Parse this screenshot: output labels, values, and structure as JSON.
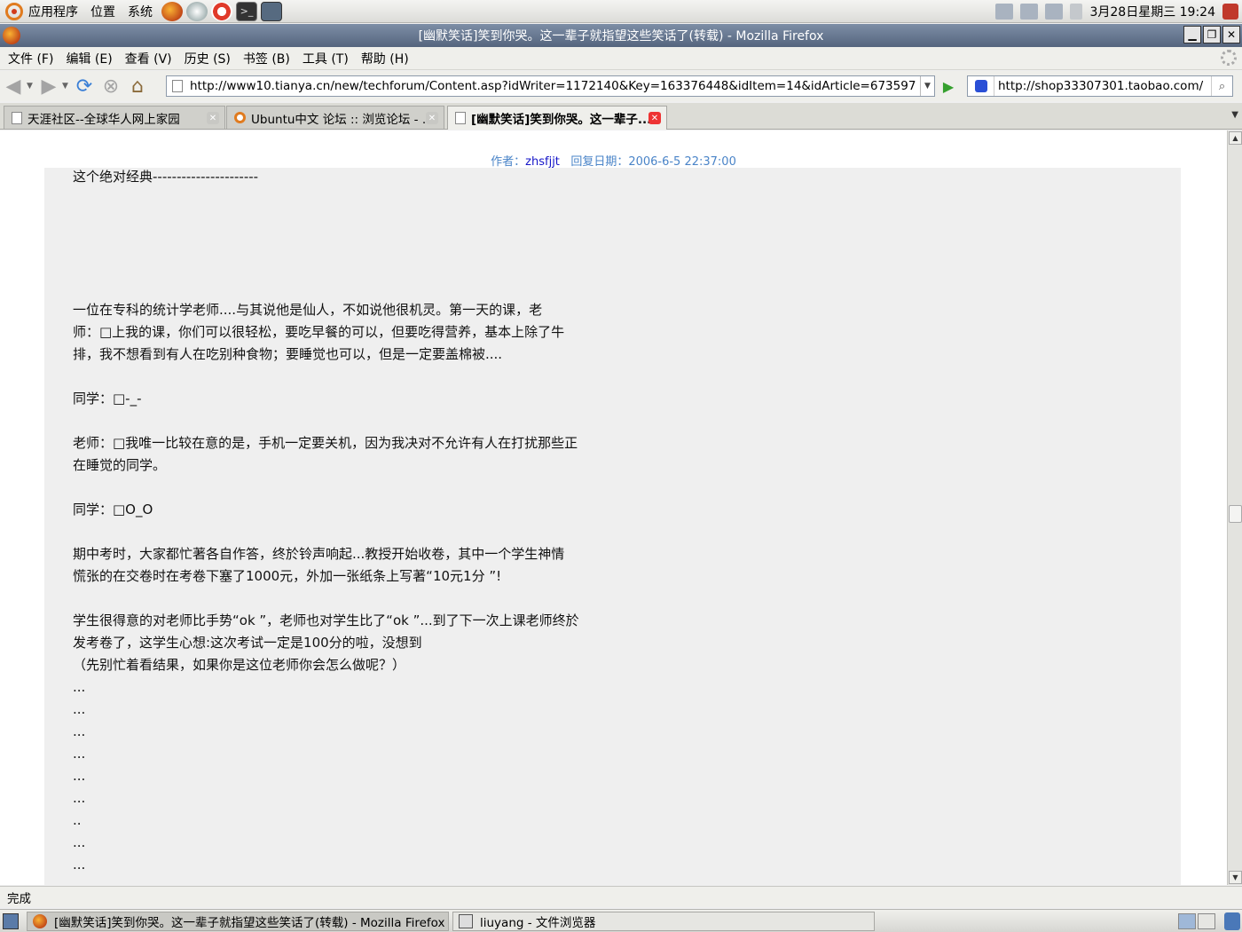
{
  "top_panel": {
    "menus": [
      "应用程序",
      "位置",
      "系统"
    ],
    "launchers": [
      "firefox-icon",
      "evolution-icon",
      "help-icon",
      "terminal-icon",
      "window-icon"
    ],
    "clock": "3月28日星期三 19:24"
  },
  "window": {
    "title": "[幽默笑话]笑到你哭。这一辈子就指望这些笑话了(转载) - Mozilla Firefox",
    "minimize": "▁",
    "maximize": "❐",
    "close": "✕"
  },
  "menubar": {
    "items": [
      "文件 (F)",
      "编辑 (E)",
      "查看 (V)",
      "历史 (S)",
      "书签 (B)",
      "工具 (T)",
      "帮助 (H)"
    ]
  },
  "navbar": {
    "url": "http://www10.tianya.cn/new/techforum/Content.asp?idWriter=1172140&Key=163376448&idItem=14&idArticle=673597",
    "search_value": "http://shop33307301.taobao.com/"
  },
  "tabs": [
    {
      "label": "天涯社区--全球华人网上家园",
      "active": false
    },
    {
      "label": "Ubuntu中文 论坛 :: 浏览论坛 - ...",
      "active": false
    },
    {
      "label": "[幽默笑话]笑到你哭。这一辈子...",
      "active": true
    }
  ],
  "post": {
    "author_label": "作者：",
    "author": "zhsfjjt",
    "reply_date": "回复日期：2006-6-5 22:37:00",
    "body": "这个绝对经典----------------------\n\n\n\n\n\n一位在专科的统计学老师....与其说他是仙人，不如说他很机灵。第一天的课，老\n师：□上我的课，你们可以很轻松，要吃早餐的可以，但要吃得营养，基本上除了牛\n排，我不想看到有人在吃别种食物；要睡觉也可以，但是一定要盖棉被....\n\n同学：□-_-\n\n老师：□我唯一比较在意的是，手机一定要关机，因为我决对不允许有人在打扰那些正\n在睡觉的同学。\n\n同学：□O_O\n\n期中考时，大家都忙著各自作答，终於铃声响起...教授开始收卷，其中一个学生神情\n慌张的在交卷时在考卷下塞了1000元，外加一张纸条上写著“10元1分 ”!\n\n学生很得意的对老师比手势“ok ”，老师也对学生比了“ok ”...到了下一次上课老师终於\n发考卷了，这学生心想:这次考试一定是100分的啦，没想到\n（先别忙着看结果，如果你是这位老师你会怎么做呢？）\n...\n...\n...\n...\n...\n...\n..\n...\n..."
  },
  "status": "完成",
  "taskbar": [
    {
      "label": "[幽默笑话]笑到你哭。这一辈子就指望这些笑话了(转载) - Mozilla Firefox",
      "active": true
    },
    {
      "label": "liuyang - 文件浏览器",
      "active": false
    }
  ]
}
